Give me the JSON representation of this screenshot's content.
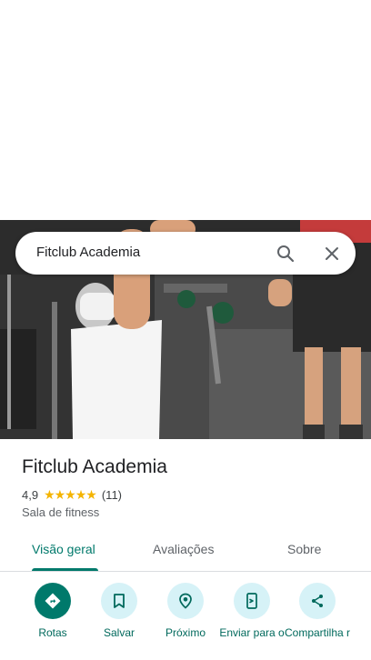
{
  "search": {
    "query": "Fitclub Academia"
  },
  "place": {
    "title": "Fitclub Academia",
    "rating": "4,9",
    "stars": "★★★★★",
    "review_count": "(11)",
    "category": "Sala de fitness"
  },
  "tabs": [
    {
      "label": "Visão geral",
      "active": true
    },
    {
      "label": "Avaliações"
    },
    {
      "label": "Sobre"
    }
  ],
  "actions": [
    {
      "label": "Rotas",
      "icon": "directions-icon"
    },
    {
      "label": "Salvar",
      "icon": "bookmark-icon"
    },
    {
      "label": "Próximo",
      "icon": "nearby-icon"
    },
    {
      "label": "Enviar para o",
      "icon": "send-to-phone-icon"
    },
    {
      "label": "Compartilha r",
      "icon": "share-icon"
    }
  ],
  "colors": {
    "accent": "#00796b",
    "action_bg": "#d6f2f7",
    "star": "#f4b400"
  }
}
